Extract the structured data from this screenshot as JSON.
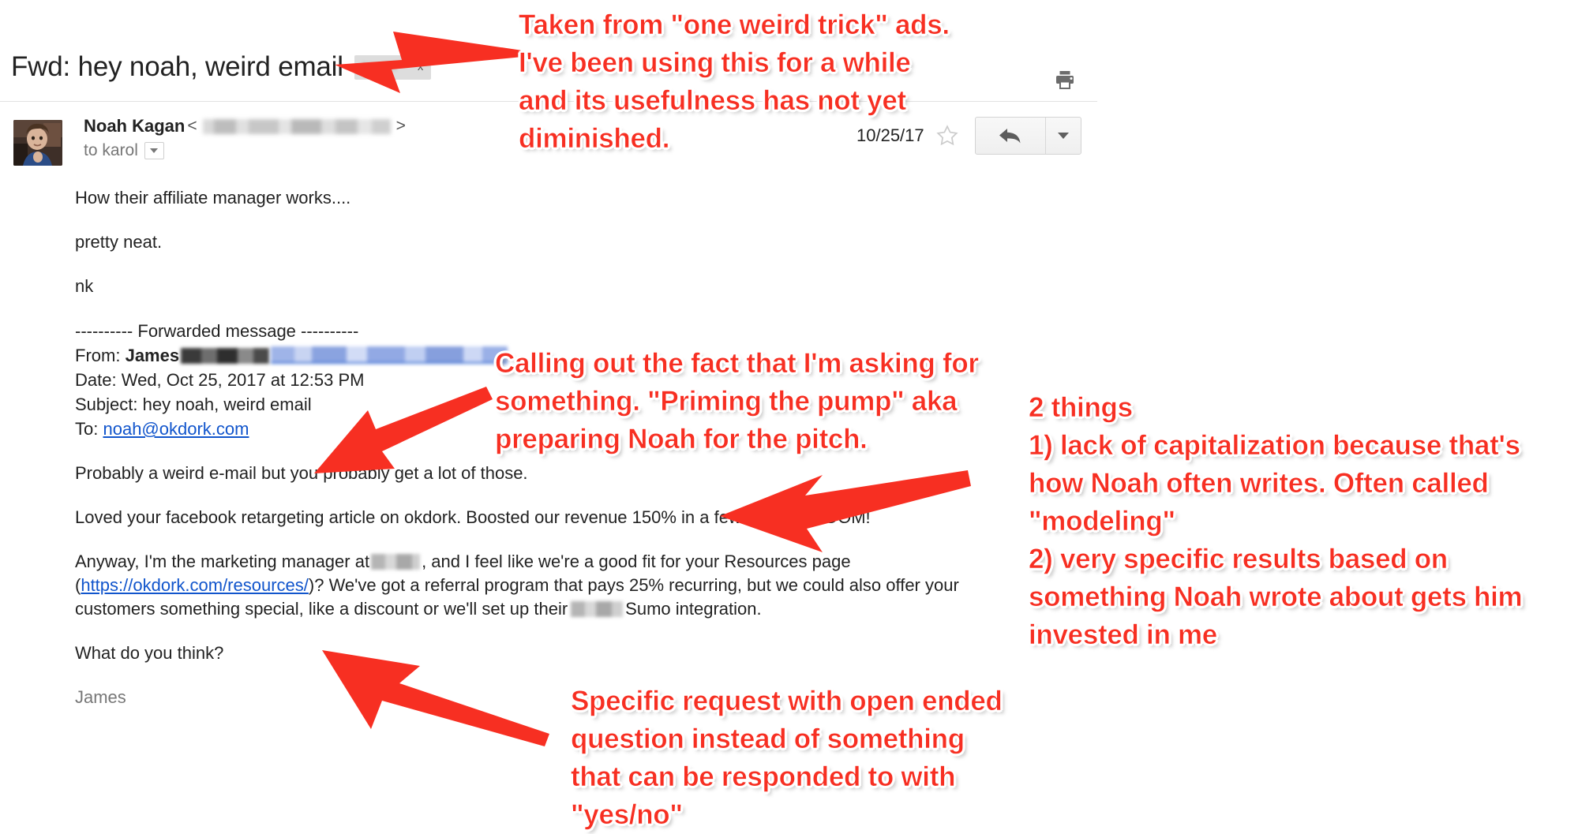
{
  "window": {
    "app": "Gmail message view",
    "subject": "Fwd: hey noah, weird email",
    "label_chip_close": "x"
  },
  "toolbar": {
    "print_icon": "print-icon"
  },
  "message": {
    "sender_name": "Noah Kagan",
    "angle_open": "<",
    "angle_close": ">",
    "to_line": "to karol",
    "date": "10/25/17",
    "star_icon": "star-icon",
    "reply_icon": "reply-arrow-icon",
    "more_icon": "chevron-down-icon",
    "details_caret": "chevron-down-icon"
  },
  "body": {
    "line_1": "How their affiliate manager works....",
    "line_2": "pretty neat.",
    "line_3": "nk",
    "forwarded_divider": "---------- Forwarded message ----------",
    "from_label": "From:",
    "from_name": "James",
    "date_label": "Date:",
    "date_value": "Wed, Oct 25, 2017 at 12:53 PM",
    "subject_label": "Subject:",
    "subject_value": "hey noah, weird email",
    "to_label": "To:",
    "to_value": "noah@okdork.com",
    "para_1": "Probably a weird e-mail but you probably get a lot of those.",
    "para_2": "Loved your facebook retargeting article on okdork. Boosted our revenue 150% in a few months. BOOM!",
    "para_3_a": "Anyway, I'm the marketing manager at",
    "para_3_b": ", and I feel like we're a good fit for your Resources page",
    "para_3_c": "(",
    "para_3_link": "https://okdork.com/resources/",
    "para_3_d": ")? We've got a referral program that pays 25% recurring, but we could also offer your",
    "para_3_e": "customers something special, like a discount or we'll set up their",
    "para_3_f": "Sumo integration.",
    "para_4": "What do you think?",
    "signature": "James"
  },
  "annotations": {
    "colors": {
      "marker_red": "#f72f22",
      "outline": "#ffffff"
    },
    "top": "Taken from \"one weird trick\" ads.\nI've been using this for a while\nand its usefulness has not yet\ndiminished.",
    "middle": "Calling out the fact that I'm asking for\nsomething. \"Priming the pump\" aka\npreparing Noah for the pitch.",
    "right": "2 things\n1) lack of capitalization because that's\nhow Noah often writes. Often called\n\"modeling\"\n2) very specific results based on\nsomething Noah wrote about gets him\ninvested in me",
    "bottom": "Specific request with open ended\nquestion instead of something\nthat can be responded to with\n\"yes/no\"",
    "arrows": [
      {
        "name": "arrow-to-subject",
        "points_to": "subject line"
      },
      {
        "name": "arrow-to-opening-line",
        "points_to": "Probably a weird e-mail paragraph"
      },
      {
        "name": "arrow-to-results-line",
        "points_to": "Boosted our revenue 150% line"
      },
      {
        "name": "arrow-to-question-line",
        "points_to": "What do you think? line"
      }
    ]
  }
}
